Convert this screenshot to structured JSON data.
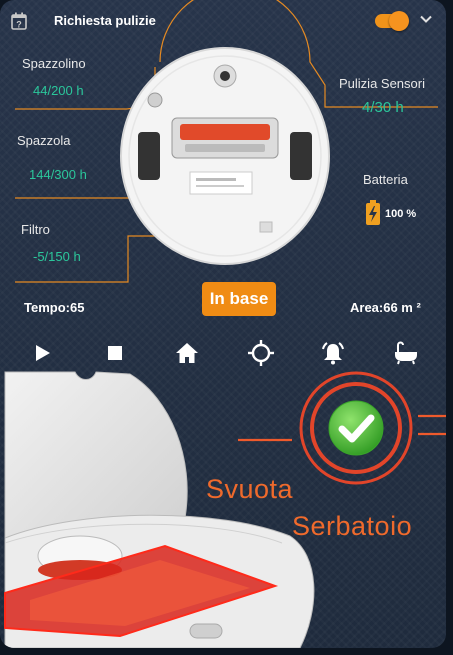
{
  "header": {
    "title": "Richiesta pulizie",
    "toggle_on": true
  },
  "consumables": {
    "brush_small": {
      "label": "Spazzolino",
      "value": "44/200 h"
    },
    "brush_main": {
      "label": "Spazzola",
      "value": "144/300 h"
    },
    "filter": {
      "label": "Filtro",
      "value": "-5/150 h"
    },
    "sensors": {
      "label": "Pulizia Sensori",
      "value": "4/30 h"
    }
  },
  "battery": {
    "label": "Batteria",
    "value": "100 %"
  },
  "status": {
    "label": "In base"
  },
  "stats": {
    "time": "Tempo:65",
    "area": "Area:66 m ²"
  },
  "controls": [
    "play-icon",
    "stop-icon",
    "home-icon",
    "locate-icon",
    "alarm-bell-icon",
    "bathtub-icon"
  ],
  "dock": {
    "line1": "Svuota",
    "line2": "Serbatoio"
  },
  "colors": {
    "accent": "#f08c14",
    "value": "#2bc79b",
    "alert": "#ef6a2c",
    "check": "#4cc83a"
  }
}
